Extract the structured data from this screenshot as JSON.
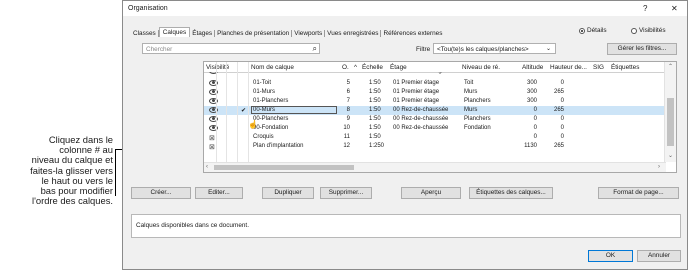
{
  "callout": {
    "lines": [
      "Cliquez dans le",
      "colonne # au",
      "niveau du calque et",
      "faites-la glisser vers",
      "le haut ou vers le",
      "bas pour modifier",
      "l'ordre des calques."
    ]
  },
  "window": {
    "title": "Organisation",
    "help": "?",
    "close": "✕"
  },
  "tabs": [
    "Classes",
    "Calques",
    "Étages",
    "Planches de présentation",
    "Viewports",
    "Vues enregistrées",
    "Références externes"
  ],
  "view_mode": {
    "details": "Détails",
    "visibility": "Visibilités"
  },
  "search": {
    "placeholder": "Chercher"
  },
  "filter": {
    "label": "Filtre",
    "value": "<Tou(te)s les calques/planches>"
  },
  "manage_filters": "Gérer les filtres...",
  "columns": [
    "Visibilité",
    "Nom de calque",
    "O.",
    "Échelle",
    "Étage",
    "Niveau de ré.",
    "Altitude",
    "Hauteur de...",
    "SIG",
    "Étiquettes"
  ],
  "rows": [
    {
      "vis": "eye",
      "check": "",
      "name": "02-Planchers",
      "order": "4",
      "scale": "1:50",
      "story": "02 Deuxième étage",
      "level": "Planchers",
      "alt": "600",
      "height": "0",
      "selected": false
    },
    {
      "vis": "eye",
      "check": "",
      "name": "01-Toit",
      "order": "5",
      "scale": "1:50",
      "story": "01 Premier étage",
      "level": "Toit",
      "alt": "300",
      "height": "0",
      "selected": false
    },
    {
      "vis": "eye",
      "check": "",
      "name": "01-Murs",
      "order": "6",
      "scale": "1:50",
      "story": "01 Premier étage",
      "level": "Murs",
      "alt": "300",
      "height": "265",
      "selected": false
    },
    {
      "vis": "eye",
      "check": "",
      "name": "01-Planchers",
      "order": "7",
      "scale": "1:50",
      "story": "01 Premier étage",
      "level": "Planchers",
      "alt": "300",
      "height": "0",
      "selected": false
    },
    {
      "vis": "eye",
      "check": "✔",
      "name": "00-Murs",
      "order": "8",
      "scale": "1:50",
      "story": "00 Rez-de-chaussée",
      "level": "Murs",
      "alt": "0",
      "height": "265",
      "selected": true
    },
    {
      "vis": "eye",
      "check": "",
      "name": "00-Planchers",
      "order": "9",
      "scale": "1:50",
      "story": "00 Rez-de-chaussée",
      "level": "Planchers",
      "alt": "0",
      "height": "0",
      "selected": false
    },
    {
      "vis": "eye",
      "check": "",
      "name": "00-Fondation",
      "order": "10",
      "scale": "1:50",
      "story": "00 Rez-de-chaussée",
      "level": "Fondation",
      "alt": "0",
      "height": "0",
      "selected": false
    },
    {
      "vis": "hidden",
      "check": "",
      "name": "Croquis",
      "order": "11",
      "scale": "1:50",
      "story": "",
      "level": "",
      "alt": "0",
      "height": "0",
      "selected": false
    },
    {
      "vis": "hidden",
      "check": "",
      "name": "Plan d'implantation",
      "order": "12",
      "scale": "1:250",
      "story": "",
      "level": "",
      "alt": "1130",
      "height": "265",
      "selected": false
    }
  ],
  "buttons": {
    "create": "Créer...",
    "edit": "Editer...",
    "duplicate": "Dupliquer",
    "delete": "Supprimer...",
    "preview": "Aperçu",
    "data_tags": "Étiquettes des calques...",
    "page_format": "Format de page...",
    "ok": "OK",
    "cancel": "Annuler"
  },
  "status": "Calques disponibles dans ce document.",
  "colors": {
    "selected_row": "#cce4f7",
    "window_bg": "#f0f0f0"
  }
}
